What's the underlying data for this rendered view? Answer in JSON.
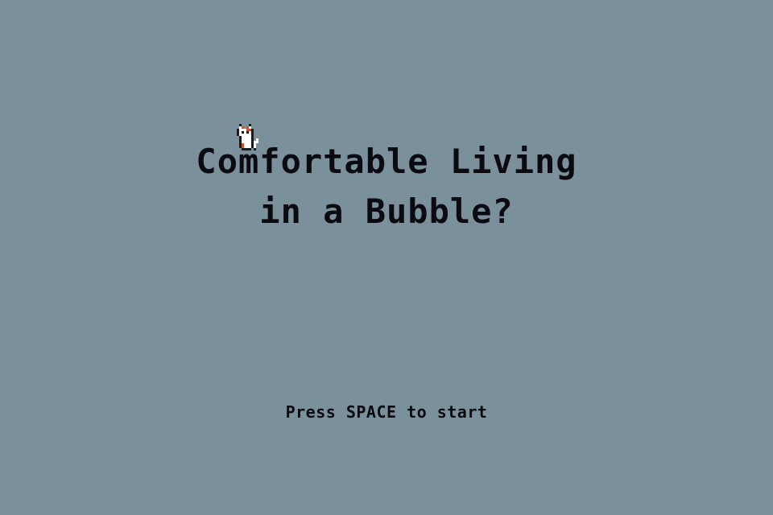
{
  "screen": {
    "background_color": "#7a919c",
    "text_color": "#0a0a10"
  },
  "title": {
    "line1": "Comfortable Living",
    "line2": "in a Bubble?"
  },
  "cat_sprite": {
    "icon": "cat-icon",
    "colors": [
      "#ffffff",
      "#c8552d",
      "#1a1a1a"
    ]
  },
  "prompt": {
    "text": "Press SPACE to start"
  }
}
